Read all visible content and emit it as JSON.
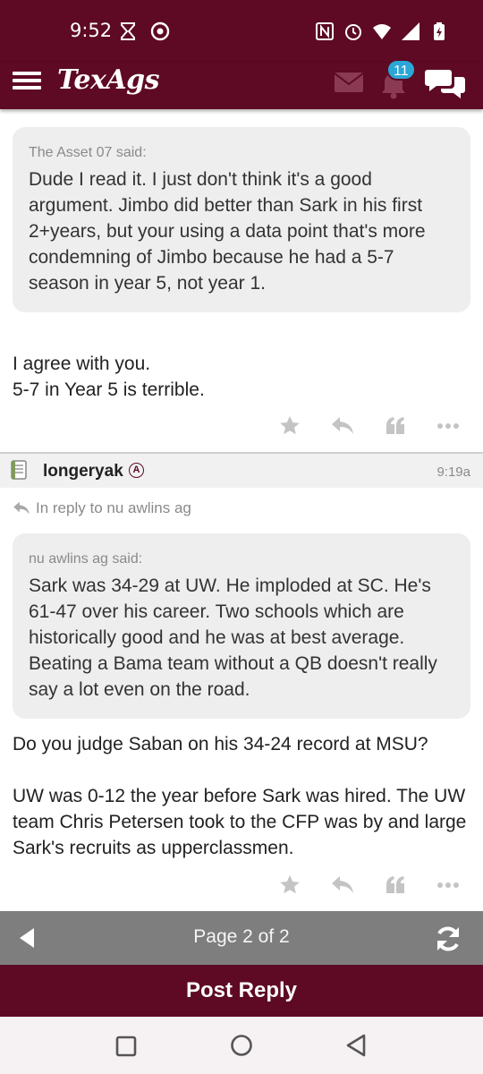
{
  "status_bar": {
    "time": "9:52",
    "left_icons": [
      "hourglass-icon",
      "chrome-icon"
    ],
    "right_icons": [
      "nfc-icon",
      "alarm-icon",
      "wifi-icon",
      "signal-icon",
      "battery-icon"
    ]
  },
  "app_bar": {
    "logo": "TexAgs",
    "notification_count": "11",
    "colors": {
      "brand": "#5e0a24",
      "badge": "#2aa7d6"
    }
  },
  "post1": {
    "quote_by": "The Asset 07 said:",
    "quote_text": "Dude I read it. I just don't think it's a good argument. Jimbo did better than Sark in his first 2+years, but your using a data point that's more condemning of Jimbo because he had a 5-7 season in year 5, not year 1.",
    "body_line1": "I agree with you.",
    "body_line2": "5-7 in Year 5 is terrible."
  },
  "post2": {
    "author": "longeryak",
    "rank": "A",
    "time": "9:19a",
    "reply_to": "In reply to nu awlins ag",
    "quote_by": "nu awlins ag said:",
    "quote_text": "Sark was 34-29 at UW. He imploded at SC. He's 61-47 over his career. Two schools which are historically good and he was at best average. Beating a Bama team without a QB doesn't really say a lot even on the road.",
    "body_para1": "Do you judge Saban on his 34-24 record at MSU?",
    "body_para2": "UW was 0-12 the year before Sark was hired. The UW team Chris Petersen took to the CFP was by and large Sark's recruits as upperclassmen."
  },
  "pager": {
    "label": "Page 2 of 2"
  },
  "post_reply_label": "Post Reply"
}
